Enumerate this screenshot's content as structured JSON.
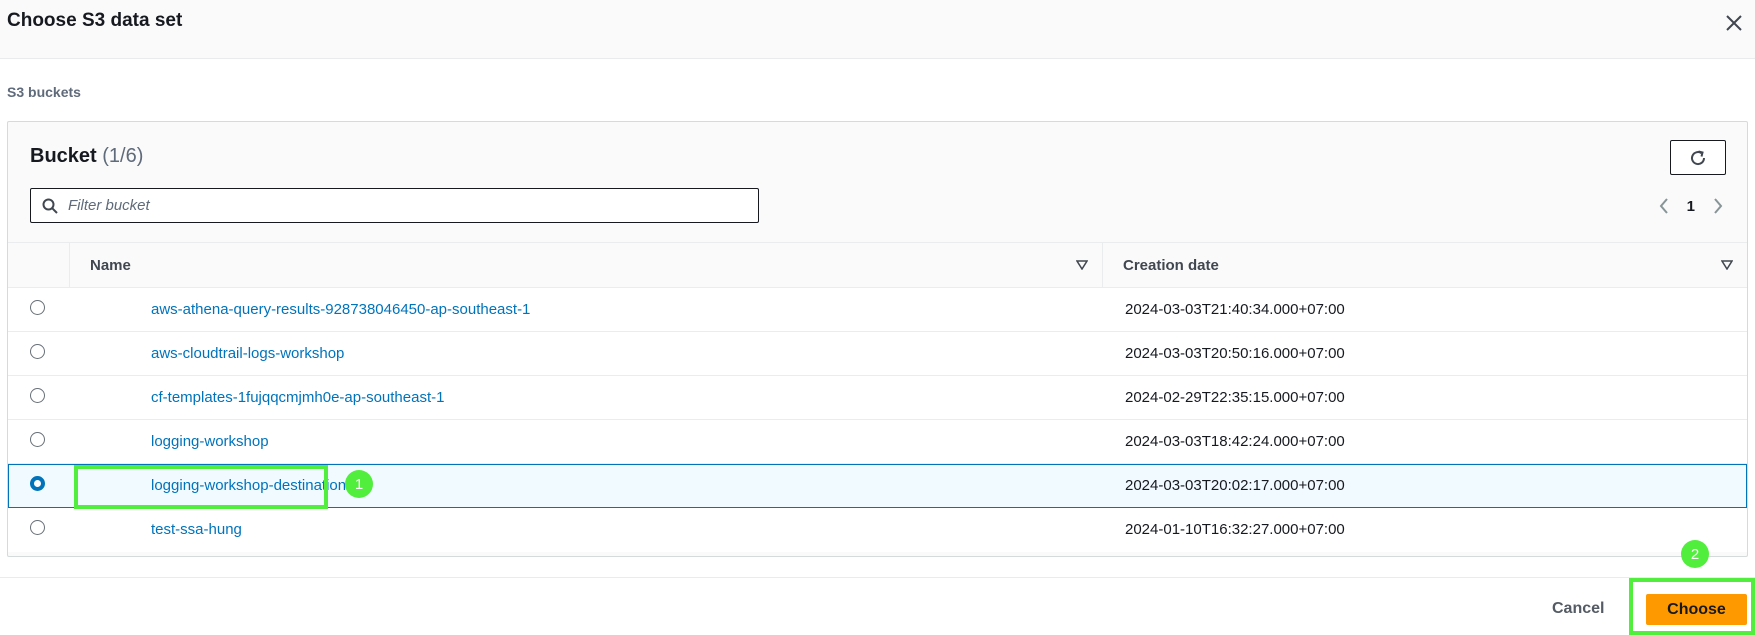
{
  "modal": {
    "title": "Choose S3 data set",
    "close_icon": "close-icon"
  },
  "section": {
    "label": "S3 buckets"
  },
  "table": {
    "heading": "Bucket",
    "count": "(1/6)",
    "refresh_icon": "refresh-icon",
    "filter": {
      "placeholder": "Filter bucket",
      "value": "",
      "icon": "search-icon"
    },
    "pagination": {
      "page": "1",
      "prev_icon": "chevron-left-icon",
      "next_icon": "chevron-right-icon"
    },
    "columns": [
      {
        "label": "Name",
        "sort_icon": "sort-down-icon"
      },
      {
        "label": "Creation date",
        "sort_icon": "sort-down-icon"
      }
    ],
    "rows": [
      {
        "name": "aws-athena-query-results-928738046450-ap-southeast-1",
        "date": "2024-03-03T21:40:34.000+07:00",
        "selected": false
      },
      {
        "name": "aws-cloudtrail-logs-workshop",
        "date": "2024-03-03T20:50:16.000+07:00",
        "selected": false
      },
      {
        "name": "cf-templates-1fujqqcmjmh0e-ap-southeast-1",
        "date": "2024-02-29T22:35:15.000+07:00",
        "selected": false
      },
      {
        "name": "logging-workshop",
        "date": "2024-03-03T18:42:24.000+07:00",
        "selected": false
      },
      {
        "name": "logging-workshop-destination",
        "date": "2024-03-03T20:02:17.000+07:00",
        "selected": true
      },
      {
        "name": "test-ssa-hung",
        "date": "2024-01-10T16:32:27.000+07:00",
        "selected": false
      }
    ]
  },
  "footer": {
    "cancel_label": "Cancel",
    "choose_label": "Choose"
  },
  "annotations": {
    "badge_1": "1",
    "badge_2": "2",
    "highlight_color": "#52ee3d"
  },
  "colors": {
    "primary_button": "#ff9900",
    "link": "#0073bb",
    "selected_row_bg": "#f1faff"
  }
}
